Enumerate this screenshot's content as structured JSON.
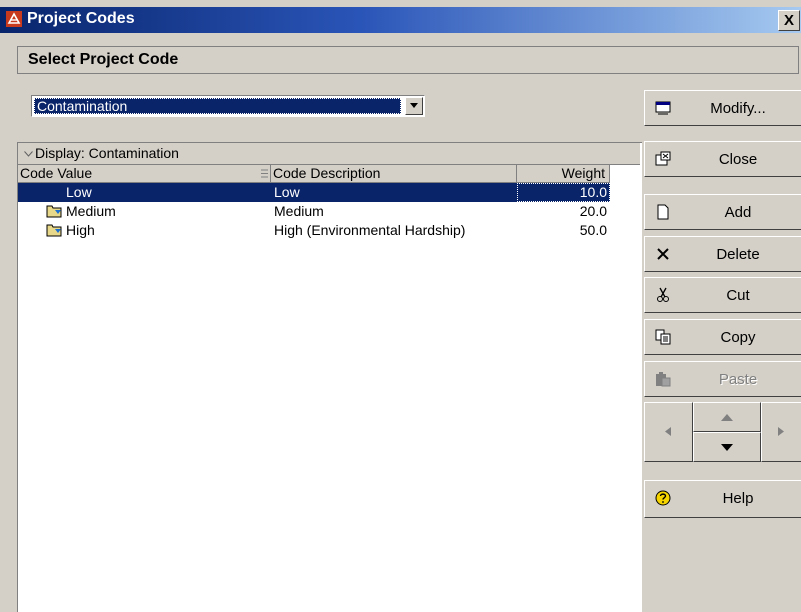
{
  "window": {
    "title": "Project Codes",
    "close_glyph": "X"
  },
  "header": {
    "title": "Select Project Code"
  },
  "code_select": {
    "selected": "Contamination"
  },
  "grid": {
    "group_label": "Display: Contamination",
    "columns": [
      "Code Value",
      "Code Description",
      "Weight"
    ],
    "rows": [
      {
        "value": "Low",
        "description": "Low",
        "weight": "10.0",
        "selected": true
      },
      {
        "value": "Medium",
        "description": "Medium",
        "weight": "20.0",
        "selected": false
      },
      {
        "value": "High",
        "description": "High (Environmental Hardship)",
        "weight": "50.0",
        "selected": false
      }
    ]
  },
  "buttons": {
    "modify": "Modify...",
    "close": "Close",
    "add": "Add",
    "delete": "Delete",
    "cut": "Cut",
    "copy": "Copy",
    "paste": "Paste",
    "help": "Help"
  },
  "icons": {
    "app": "project-codes-icon",
    "modify": "modify-icon",
    "close": "close-window-icon",
    "add": "new-document-icon",
    "delete": "x-delete-icon",
    "cut": "scissors-icon",
    "copy": "copy-icon",
    "paste": "paste-icon",
    "help": "help-icon",
    "row": "folder-icon"
  },
  "colors": {
    "selection": "#0a246a",
    "title_bar": "#08246b",
    "face": "#d4d0c8"
  }
}
